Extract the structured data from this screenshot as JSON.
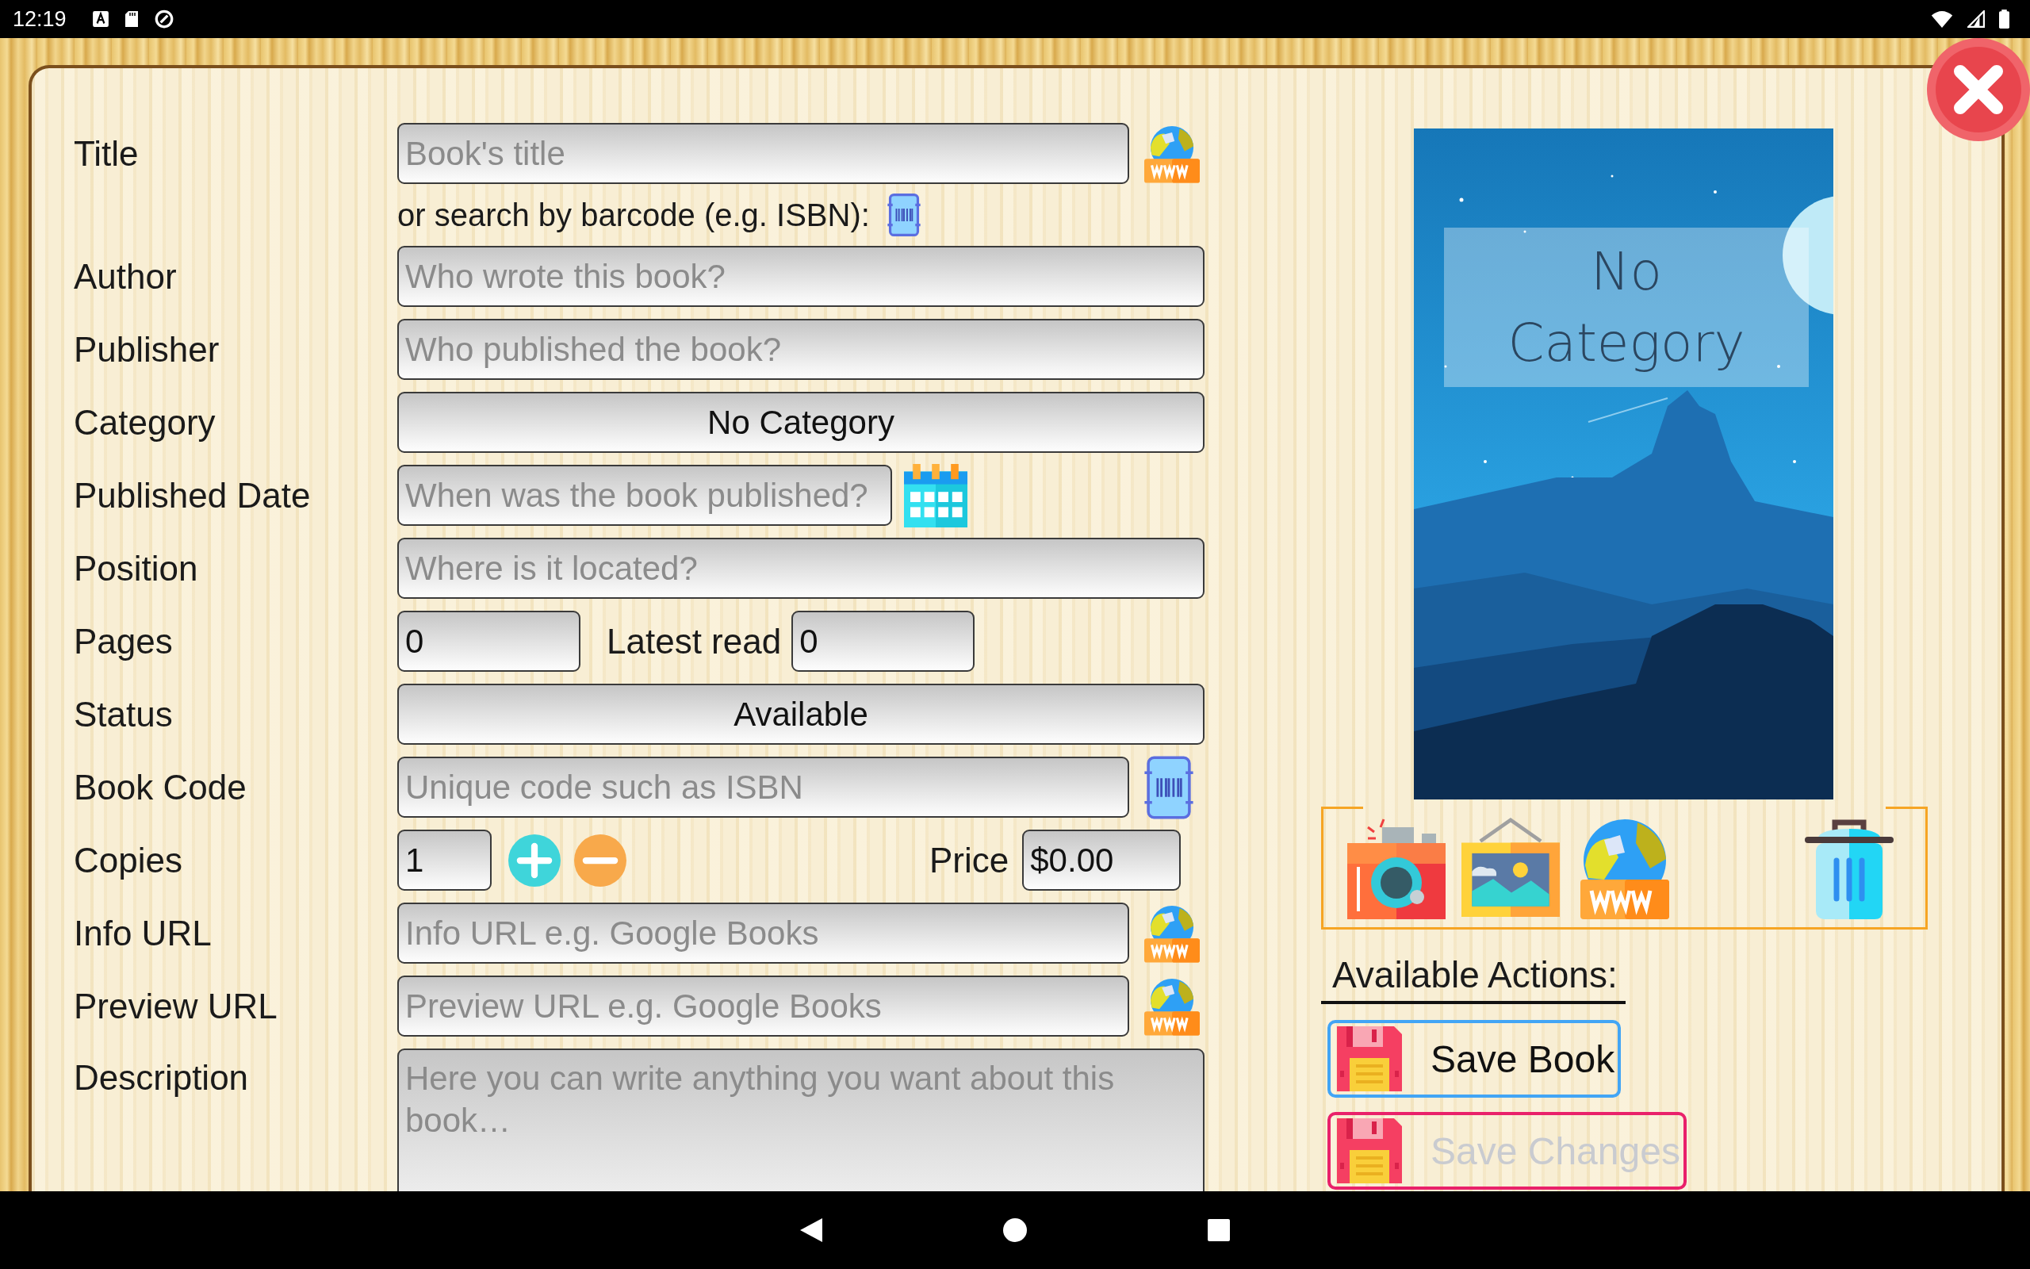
{
  "status_bar": {
    "time": "12:19"
  },
  "form": {
    "rows": [
      {
        "kind": "web",
        "label": "Title",
        "placeholder": "Book's title"
      },
      {
        "kind": "hint",
        "text": "or search by barcode (e.g. ISBN):"
      },
      {
        "kind": "text",
        "label": "Author",
        "placeholder": "Who wrote this book?"
      },
      {
        "kind": "text",
        "label": "Publisher",
        "placeholder": "Who published the book?"
      },
      {
        "kind": "select",
        "label": "Category",
        "value": "No Category"
      },
      {
        "kind": "date",
        "label": "Published Date",
        "placeholder": "When was the book published?"
      },
      {
        "kind": "text",
        "label": "Position",
        "placeholder": "Where is it located?"
      },
      {
        "kind": "pages",
        "label": "Pages",
        "value": "0",
        "latest_label": "Latest read",
        "latest_value": "0"
      },
      {
        "kind": "select",
        "label": "Status",
        "value": "Available"
      },
      {
        "kind": "scan",
        "label": "Book Code",
        "placeholder": "Unique code such as ISBN"
      },
      {
        "kind": "copies",
        "label": "Copies",
        "value": "1",
        "price_label": "Price",
        "price_value": "$0.00"
      },
      {
        "kind": "web",
        "label": "Info URL",
        "placeholder": "Info URL e.g. Google Books"
      },
      {
        "kind": "web",
        "label": "Preview URL",
        "placeholder": "Preview URL e.g. Google Books"
      },
      {
        "kind": "textarea",
        "label": "Description",
        "placeholder": "Here you can write anything you want about this book…"
      }
    ]
  },
  "cover": {
    "title": "No Category"
  },
  "actions": {
    "title": "Available Actions:",
    "buttons": [
      {
        "label": "Save Book",
        "disabled": false
      },
      {
        "label": "Save Changes",
        "disabled": true
      }
    ]
  }
}
